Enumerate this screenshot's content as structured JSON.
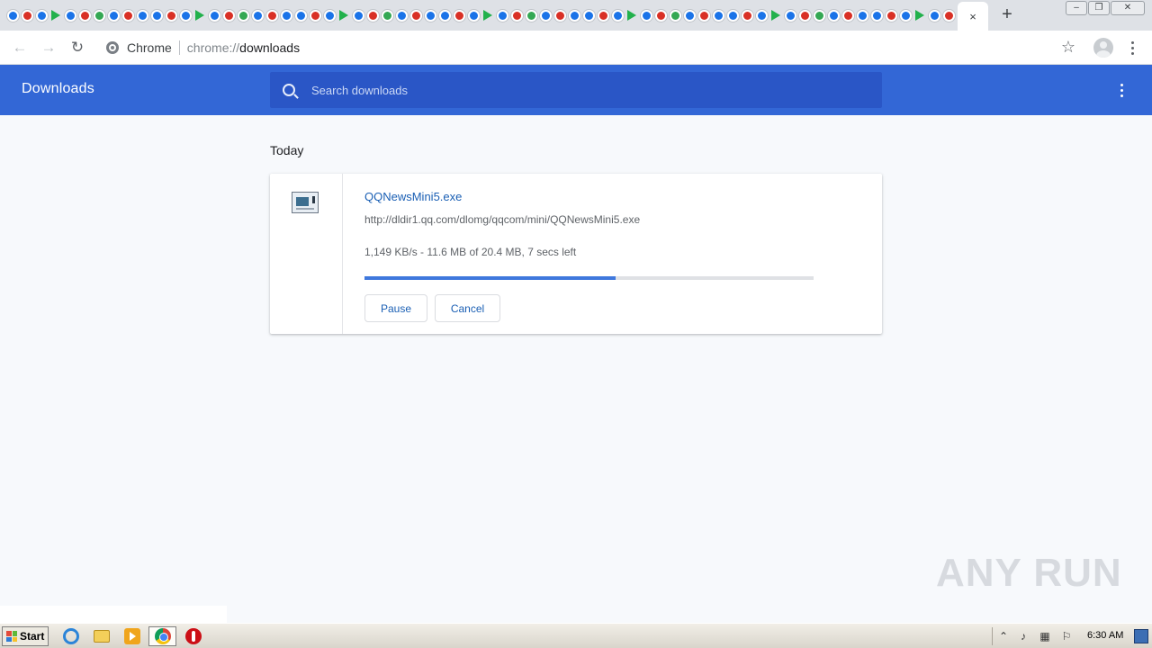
{
  "browser": {
    "tab_close_label": "×",
    "new_tab_label": "+",
    "omnibox": {
      "chip": "Chrome",
      "scheme": "chrome://",
      "path": "downloads"
    }
  },
  "header": {
    "title": "Downloads",
    "search_placeholder": "Search downloads"
  },
  "downloads": {
    "date_heading": "Today",
    "item": {
      "file_name": "QQNewsMini5.exe",
      "url": "http://dldir1.qq.com/dlomg/qqcom/mini/QQNewsMini5.exe",
      "status": "1,149 KB/s - 11.6 MB of 20.4 MB, 7 secs left",
      "progress_fraction": 0.56,
      "pause_label": "Pause",
      "cancel_label": "Cancel"
    }
  },
  "watermark": {
    "text": "ANY RUN"
  },
  "taskbar": {
    "start_label": "Start",
    "clock": "6:30 AM"
  },
  "colors": {
    "header_blue": "#3367d6",
    "search_blue": "#2a56c6",
    "link_blue": "#1a5fb4",
    "progress_blue": "#3f78dd"
  }
}
